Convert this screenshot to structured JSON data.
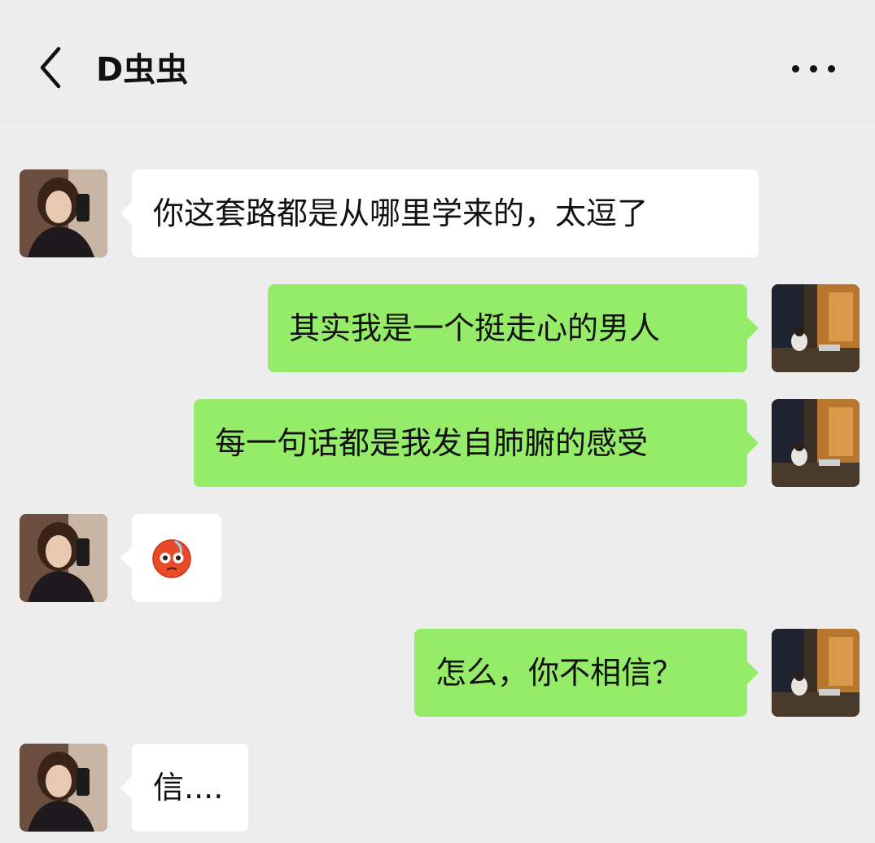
{
  "header": {
    "title": "D虫虫",
    "back_icon": "chevron-left-icon",
    "more_icon": "more-dots-icon"
  },
  "colors": {
    "background": "#ededed",
    "incoming_bubble": "#ffffff",
    "outgoing_bubble": "#95ec69"
  },
  "messages": [
    {
      "sender": "contact",
      "type": "text",
      "text": "你这套路都是从哪里学来的，太逗了"
    },
    {
      "sender": "me",
      "type": "text",
      "text": "其实我是一个挺走心的男人"
    },
    {
      "sender": "me",
      "type": "text",
      "text": "每一句话都是我发自肺腑的感受"
    },
    {
      "sender": "contact",
      "type": "emoji",
      "emoji": "flushed-face-icon"
    },
    {
      "sender": "me",
      "type": "text",
      "text": "怎么，你不相信？"
    },
    {
      "sender": "contact",
      "type": "text",
      "text": "信...."
    }
  ]
}
